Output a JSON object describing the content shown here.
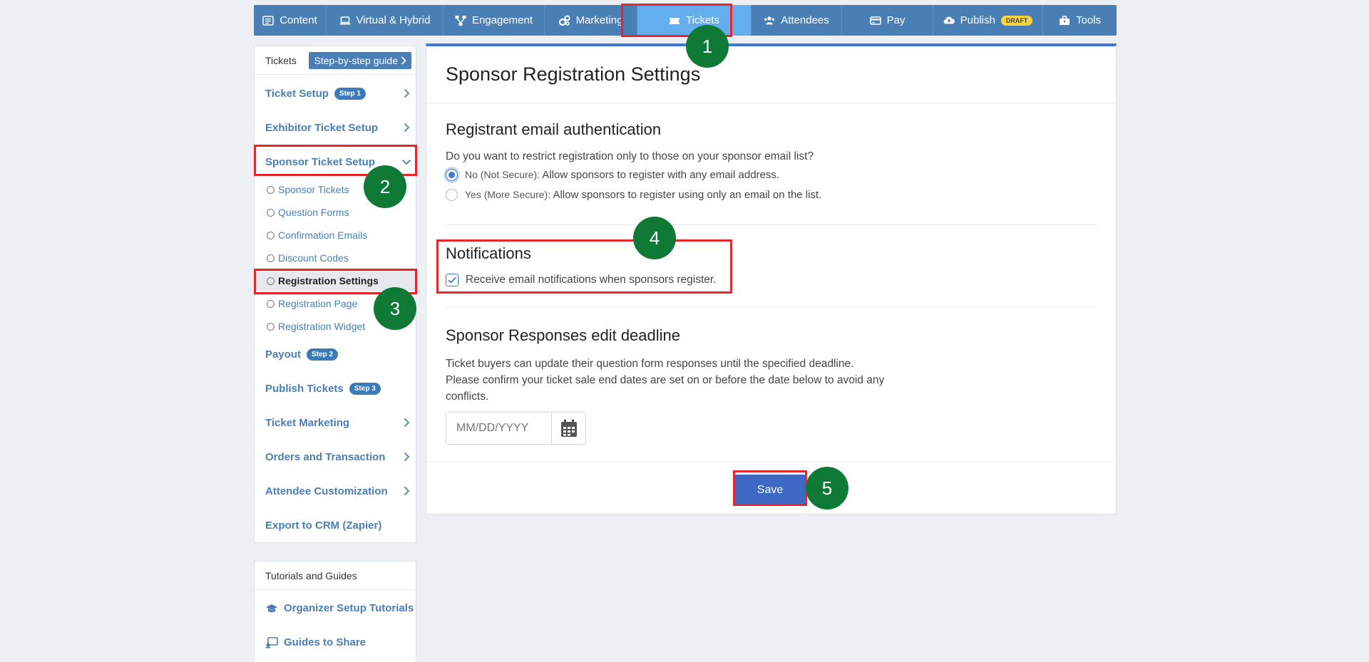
{
  "nav": {
    "items": [
      {
        "label": "Content",
        "icon": "list-icon"
      },
      {
        "label": "Virtual & Hybrid",
        "icon": "laptop-icon"
      },
      {
        "label": "Engagement",
        "icon": "network-icon"
      },
      {
        "label": "Marketing",
        "icon": "cogs-icon"
      },
      {
        "label": "Tickets",
        "icon": "ticket-icon"
      },
      {
        "label": "Attendees",
        "icon": "users-icon"
      },
      {
        "label": "Pay",
        "icon": "card-icon"
      },
      {
        "label": "Publish",
        "icon": "cloud-upload-icon",
        "badge": "DRAFT"
      },
      {
        "label": "Tools",
        "icon": "toolbox-icon"
      }
    ]
  },
  "sidebar": {
    "title": "Tickets",
    "guide_button": "Step-by-step guide",
    "items": [
      {
        "label": "Ticket Setup",
        "badge": "Step 1"
      },
      {
        "label": "Exhibitor Ticket Setup"
      },
      {
        "label": "Sponsor Ticket Setup"
      },
      {
        "label": "Payout",
        "badge": "Step 2"
      },
      {
        "label": "Publish Tickets",
        "badge": "Step 3"
      },
      {
        "label": "Ticket Marketing"
      },
      {
        "label": "Orders and Transaction"
      },
      {
        "label": "Attendee Customization"
      },
      {
        "label": "Export to CRM (Zapier)"
      }
    ],
    "sub_items": [
      "Sponsor Tickets",
      "Question Forms",
      "Confirmation Emails",
      "Discount Codes",
      "Registration Settings",
      "Registration Page",
      "Registration Widget"
    ]
  },
  "tutorials": {
    "title": "Tutorials and Guides",
    "items": [
      "Organizer Setup Tutorials",
      "Guides to Share"
    ]
  },
  "main": {
    "title": "Sponsor Registration Settings",
    "email_auth": {
      "heading": "Registrant email authentication",
      "question": "Do you want to restrict registration only to those on your sponsor email list?",
      "option_no_label": "No (Not Secure):",
      "option_no_desc": "Allow sponsors to register with any email address.",
      "option_yes_label": "Yes (More Secure):",
      "option_yes_desc": "Allow sponsors to register using only an email on the list.",
      "selected": "no"
    },
    "notifications": {
      "heading": "Notifications",
      "checkbox_label": "Receive email notifications when sponsors register.",
      "checked": true
    },
    "deadline": {
      "heading": "Sponsor Responses edit deadline",
      "line1": "Ticket buyers can update their question form responses until the specified deadline.",
      "line2": "Please confirm your ticket sale end dates are set on or before the date below to avoid any",
      "line3": "conflicts.",
      "placeholder": "MM/DD/YYYY",
      "value": ""
    },
    "save_label": "Save"
  },
  "annotations": {
    "markers": [
      "1",
      "2",
      "3",
      "4",
      "5"
    ],
    "highlight_color": "#e5262b",
    "marker_color": "#0f7a36"
  }
}
